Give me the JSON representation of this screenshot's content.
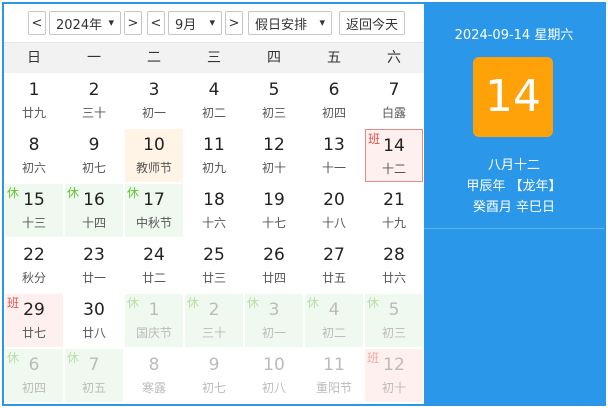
{
  "toolbar": {
    "prev_year": "<",
    "year": "2024年",
    "next_year": ">",
    "prev_month": "<",
    "month": "9月",
    "next_month": ">",
    "holiday_select": "假日安排",
    "today_button": "返回今天"
  },
  "weekdays": [
    "日",
    "一",
    "二",
    "三",
    "四",
    "五",
    "六"
  ],
  "days": [
    {
      "d": "1",
      "l": "廿九"
    },
    {
      "d": "2",
      "l": "三十"
    },
    {
      "d": "3",
      "l": "初一"
    },
    {
      "d": "4",
      "l": "初二"
    },
    {
      "d": "5",
      "l": "初三"
    },
    {
      "d": "6",
      "l": "初四"
    },
    {
      "d": "7",
      "l": "白露"
    },
    {
      "d": "8",
      "l": "初六"
    },
    {
      "d": "9",
      "l": "初七"
    },
    {
      "d": "10",
      "l": "教师节"
    },
    {
      "d": "11",
      "l": "初九"
    },
    {
      "d": "12",
      "l": "初十"
    },
    {
      "d": "13",
      "l": "十一"
    },
    {
      "d": "14",
      "l": "十二"
    },
    {
      "d": "15",
      "l": "十三"
    },
    {
      "d": "16",
      "l": "十四"
    },
    {
      "d": "17",
      "l": "中秋节"
    },
    {
      "d": "18",
      "l": "十六"
    },
    {
      "d": "19",
      "l": "十七"
    },
    {
      "d": "20",
      "l": "十八"
    },
    {
      "d": "21",
      "l": "十九"
    },
    {
      "d": "22",
      "l": "秋分"
    },
    {
      "d": "23",
      "l": "廿一"
    },
    {
      "d": "24",
      "l": "廿二"
    },
    {
      "d": "25",
      "l": "廿三"
    },
    {
      "d": "26",
      "l": "廿四"
    },
    {
      "d": "27",
      "l": "廿五"
    },
    {
      "d": "28",
      "l": "廿六"
    },
    {
      "d": "29",
      "l": "廿七"
    },
    {
      "d": "30",
      "l": "廿八"
    },
    {
      "d": "1",
      "l": "国庆节"
    },
    {
      "d": "2",
      "l": "三十"
    },
    {
      "d": "3",
      "l": "初一"
    },
    {
      "d": "4",
      "l": "初二"
    },
    {
      "d": "5",
      "l": "初三"
    },
    {
      "d": "6",
      "l": "初四"
    },
    {
      "d": "7",
      "l": "初五"
    },
    {
      "d": "8",
      "l": "寒露"
    },
    {
      "d": "9",
      "l": "初七"
    },
    {
      "d": "10",
      "l": "初八"
    },
    {
      "d": "11",
      "l": "重阳节"
    },
    {
      "d": "12",
      "l": "初十"
    }
  ],
  "tags": {
    "rest": "休",
    "work": "班"
  },
  "selected": {
    "date_line": "2024-09-14 星期六",
    "day": "14",
    "lunar": "八月十二",
    "year_ganzhi": "甲辰年 【龙年】",
    "month_day_ganzhi": "癸酉月 辛巳日"
  },
  "colors": {
    "accent": "#2b97e9",
    "day_badge": "#ffa20a",
    "rest": "#67c23a",
    "work": "#e0504a"
  }
}
